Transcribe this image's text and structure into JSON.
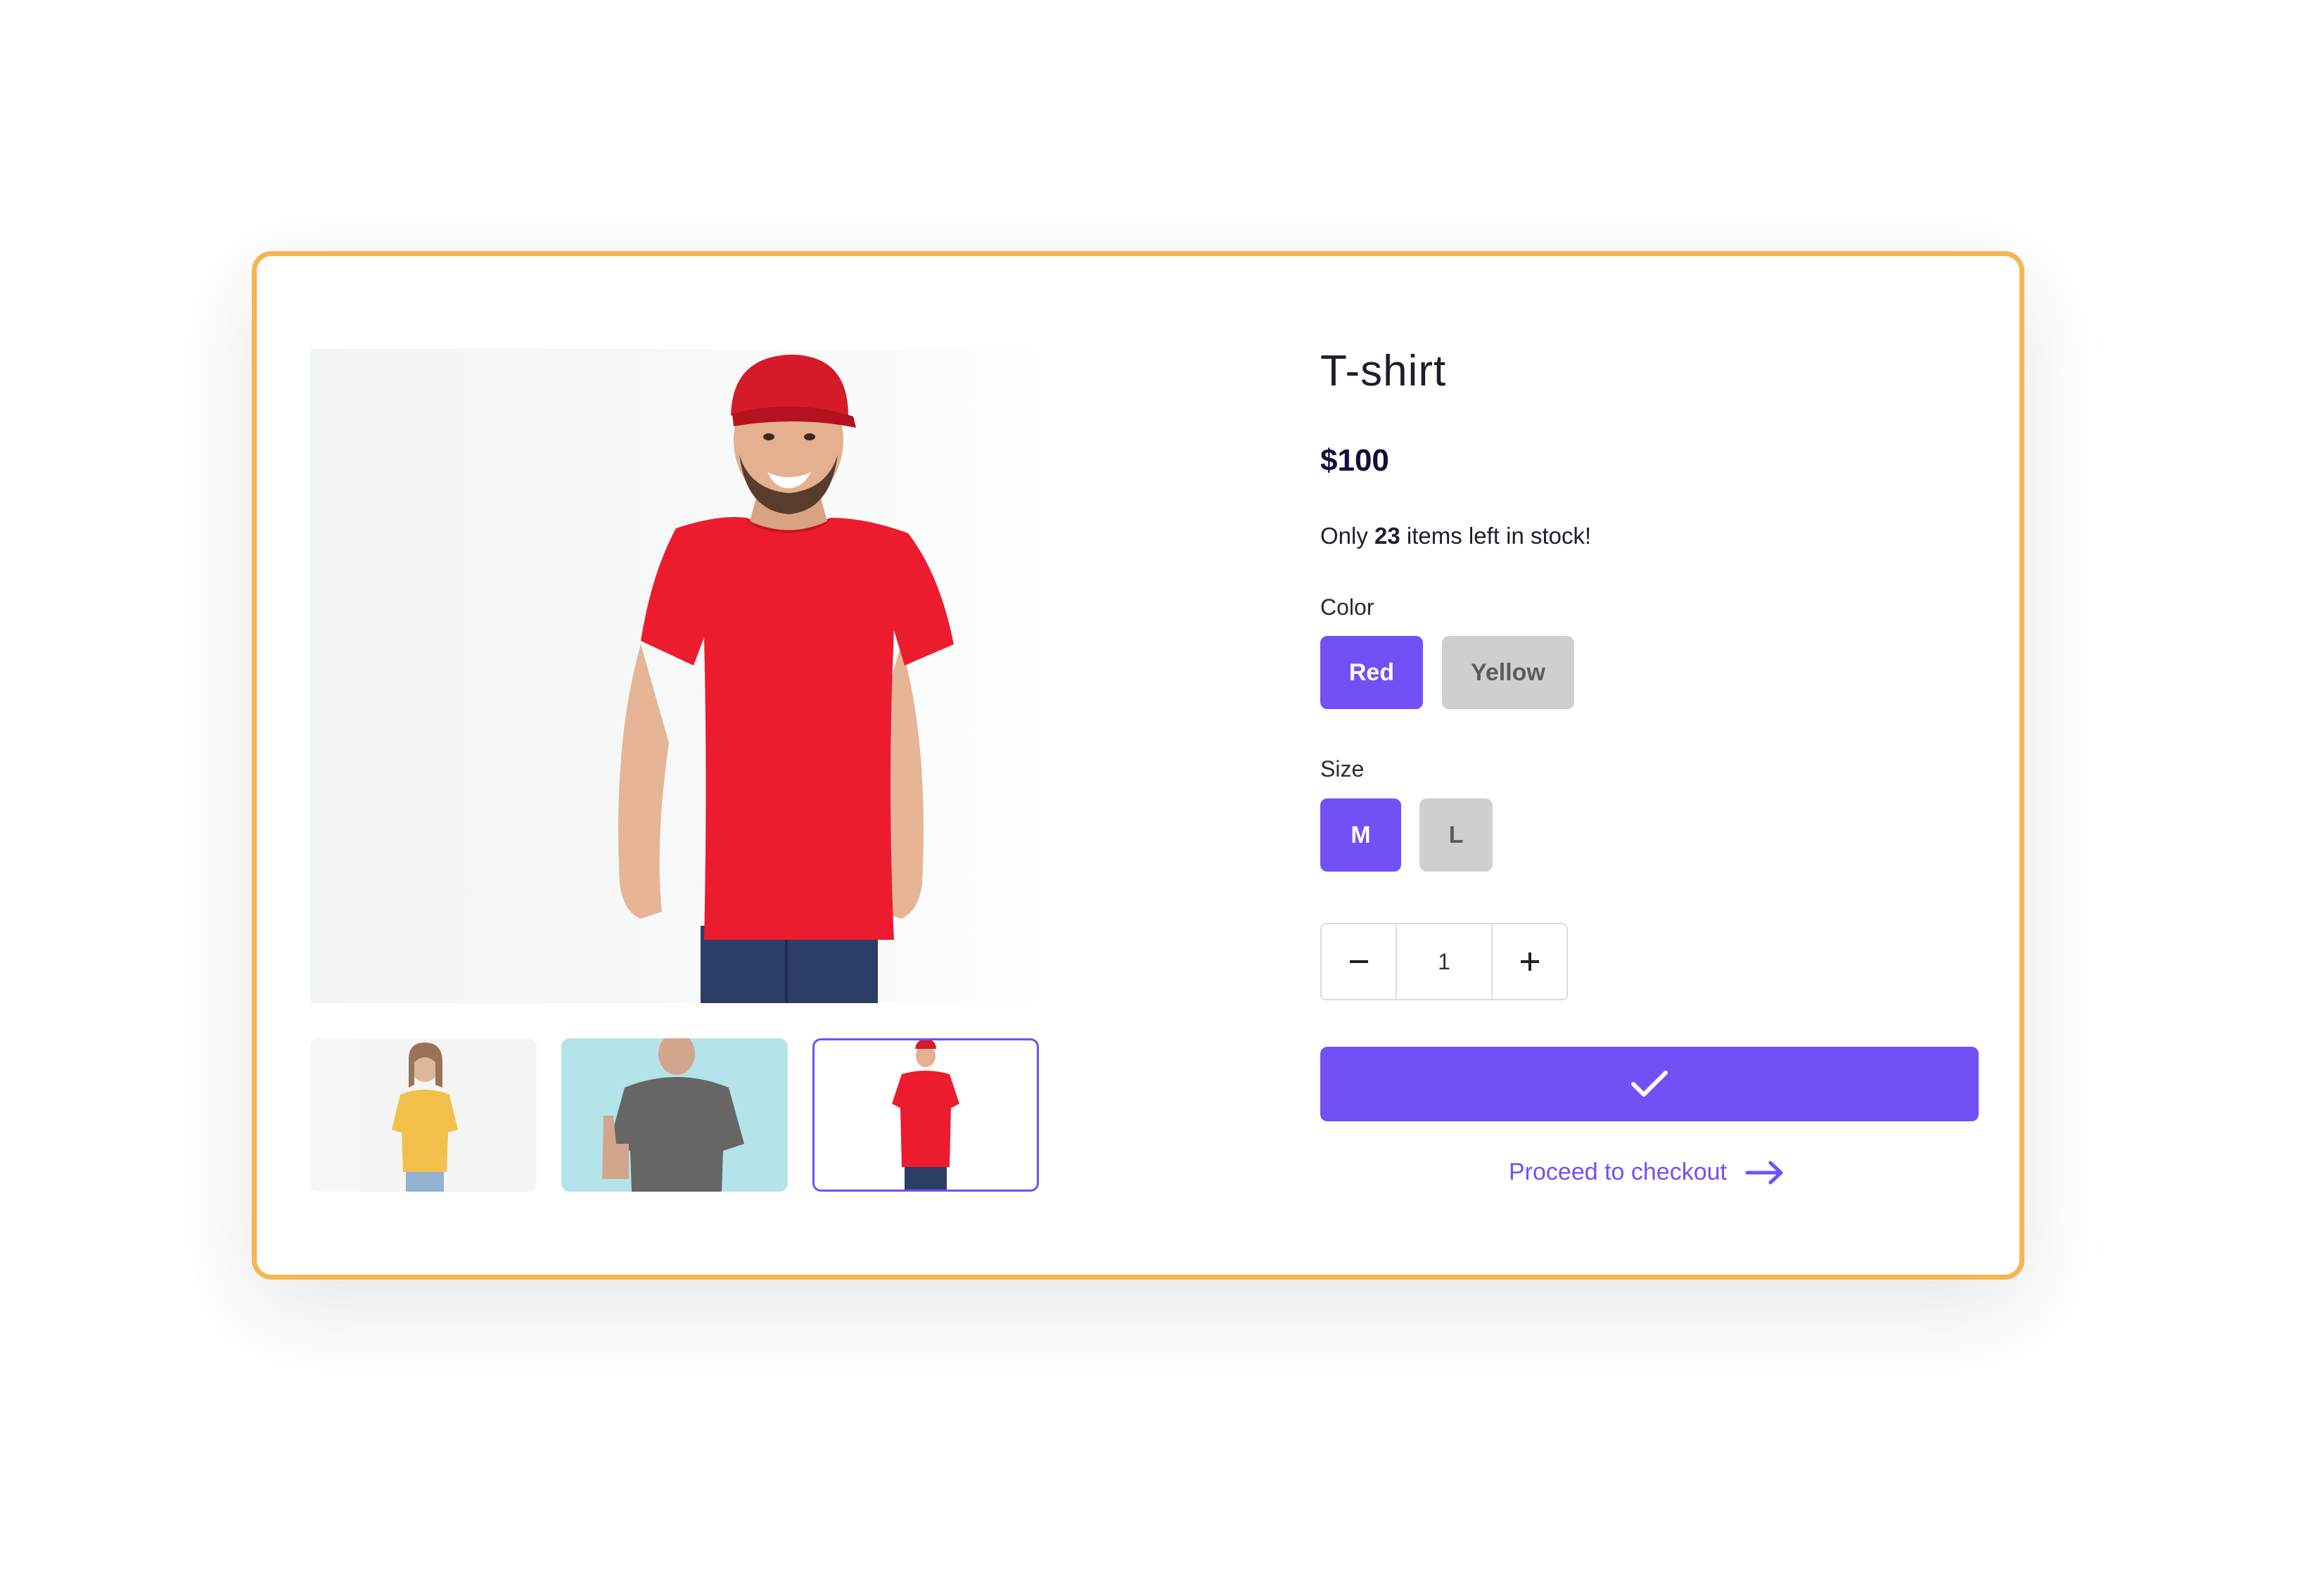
{
  "product": {
    "title": "T-shirt",
    "price": "$100",
    "stock_prefix": "Only",
    "stock_count": "23",
    "stock_suffix": "items left in stock!"
  },
  "options": {
    "color_label": "Color",
    "colors": [
      {
        "label": "Red",
        "selected": true
      },
      {
        "label": "Yellow",
        "selected": false
      }
    ],
    "size_label": "Size",
    "sizes": [
      {
        "label": "M",
        "selected": true
      },
      {
        "label": "L",
        "selected": false
      }
    ]
  },
  "quantity": {
    "value": "1",
    "decrement_icon": "minus-icon",
    "increment_icon": "plus-icon"
  },
  "actions": {
    "add_to_cart_icon": "checkmark-icon",
    "checkout_label": "Proceed to checkout",
    "checkout_icon": "arrow-right-icon"
  },
  "gallery": {
    "main_image": "man-red-cap-red-tshirt",
    "thumbnails": [
      {
        "name": "woman-yellow-tshirt",
        "selected": false
      },
      {
        "name": "man-gray-tshirt-thumbs-up",
        "selected": false
      },
      {
        "name": "man-red-tshirt",
        "selected": true
      }
    ]
  },
  "colors": {
    "accent": "#7150f6",
    "card_border": "#f6b452",
    "inactive_option": "#cfcfcf",
    "price_text": "#140c3d"
  }
}
